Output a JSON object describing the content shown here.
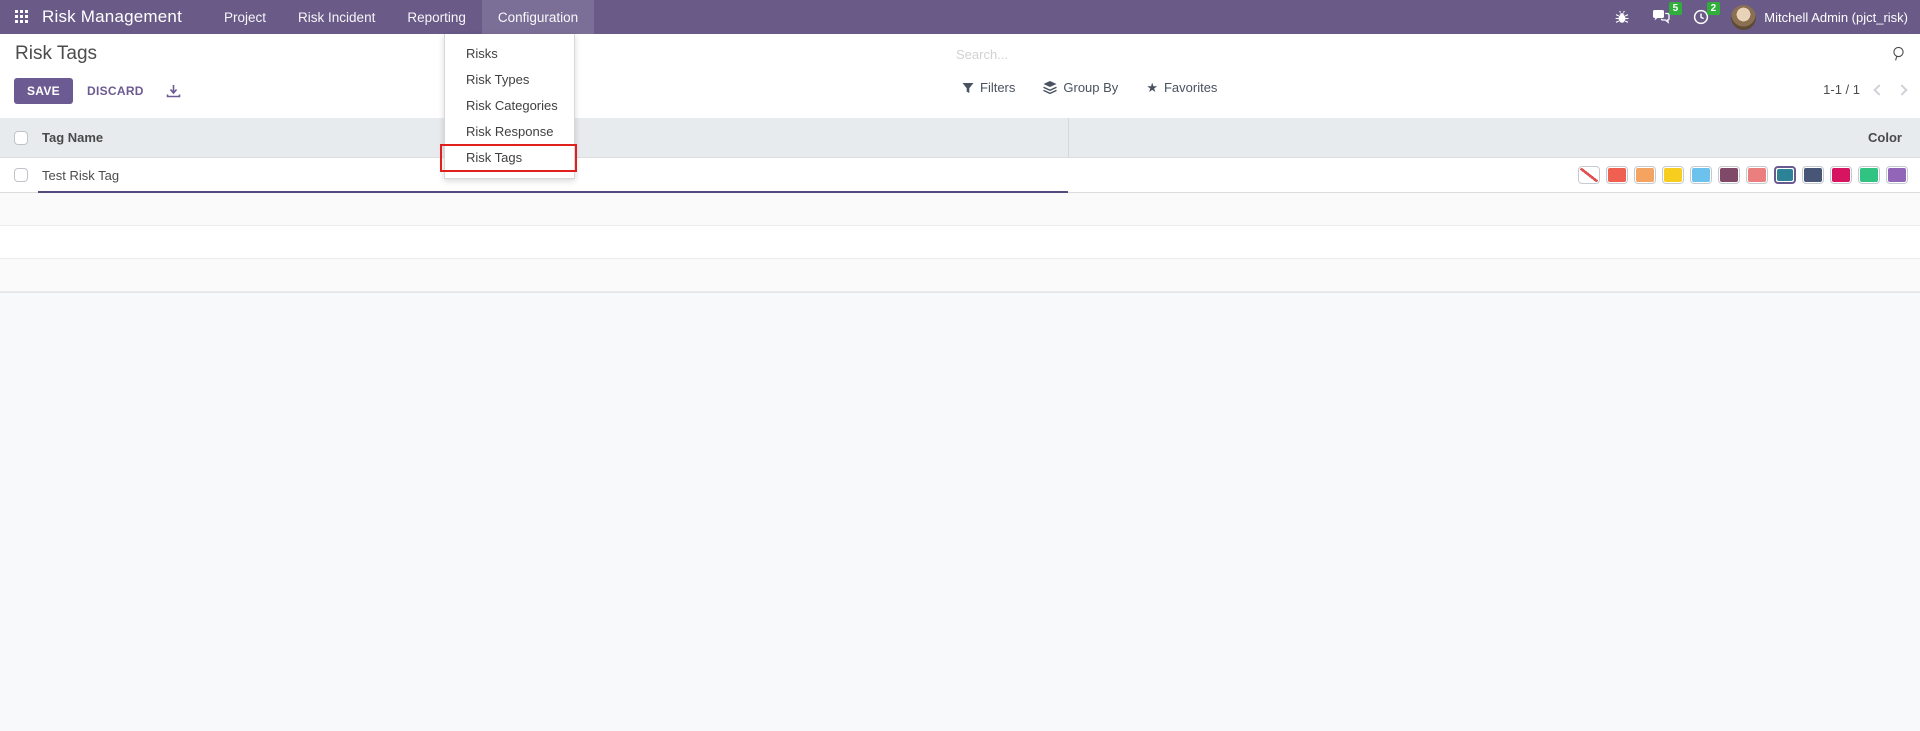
{
  "app": {
    "name": "Risk Management"
  },
  "navbar": {
    "bg_color": "#695a88",
    "active_bg_color": "#7a6c99",
    "menus": [
      {
        "label": "Project",
        "active": false
      },
      {
        "label": "Risk Incident",
        "active": false
      },
      {
        "label": "Reporting",
        "active": false
      },
      {
        "label": "Configuration",
        "active": true
      }
    ],
    "systray": {
      "icons": [
        "bug-icon",
        "messages-icon",
        "activities-clock-icon"
      ],
      "messages_badge": "5",
      "activities_badge": "2",
      "badge_color": "#2fae3c",
      "user_name": "Mitchell Admin (pjct_risk)"
    }
  },
  "configuration_menu": {
    "items": [
      {
        "label": "Risks",
        "highlighted": false
      },
      {
        "label": "Risk Types",
        "highlighted": false
      },
      {
        "label": "Risk Categories",
        "highlighted": false
      },
      {
        "label": "Risk Response",
        "highlighted": false
      },
      {
        "label": "Risk Tags",
        "highlighted": true
      }
    ],
    "highlight_border_color": "#e0201c"
  },
  "control_panel": {
    "page_title": "Risk Tags",
    "save_label": "SAVE",
    "discard_label": "DISCARD",
    "export_icon": "download-icon",
    "search_placeholder": "Search...",
    "search_icon": "magnifier-icon",
    "filters_label": "Filters",
    "filters_icon": "funnel-icon",
    "group_by_label": "Group By",
    "group_by_icon": "layers-icon",
    "favorites_label": "Favorites",
    "favorites_icon": "star-icon",
    "star_glyph": "★",
    "pager_text": "1-1 / 1"
  },
  "list": {
    "columns": {
      "tag_name": "Tag Name",
      "color": "Color"
    },
    "rows": [
      {
        "tag_name": "Test Risk Tag",
        "selected_color_index": 7
      }
    ],
    "palette": [
      "none",
      "#F06050",
      "#F4A460",
      "#F7CD1F",
      "#6CC1ED",
      "#814968",
      "#EB7E7F",
      "#2C8397",
      "#475577",
      "#D6145F",
      "#30C381",
      "#9365B8"
    ],
    "selected_ring_color": "#6a5a90",
    "accent_underline_color": "#55497d"
  }
}
